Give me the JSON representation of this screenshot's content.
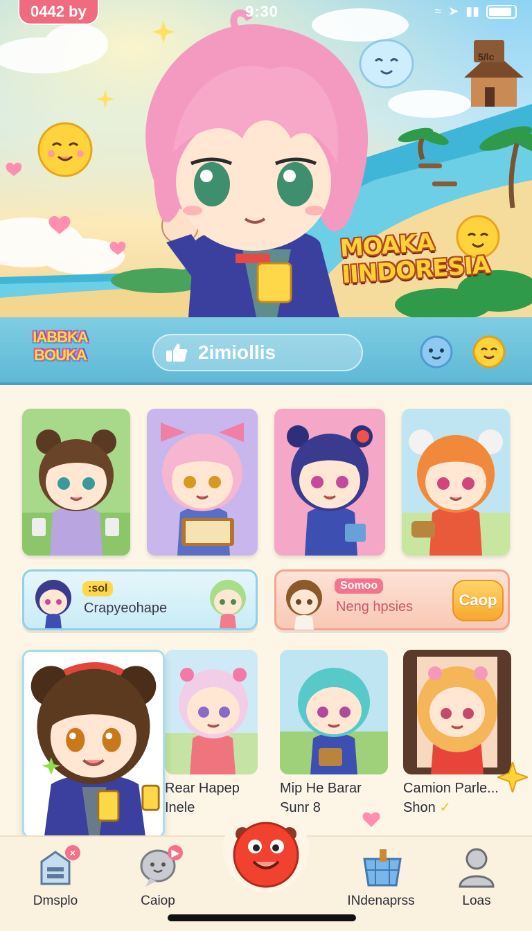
{
  "status_bar": {
    "pill_text": "0442 by",
    "time": "9:30",
    "icons": [
      "wifi-icon",
      "location-icon",
      "signal-icon",
      "battery-icon"
    ]
  },
  "hero": {
    "title_line1": "MOAKA",
    "title_line2": "IINDORESIA",
    "sign_text": "5/lc"
  },
  "header": {
    "logo_line1": "IABBKA",
    "logo_line2": "BOUKA",
    "search_value": "2imiollis",
    "search_icon": "thumbs-up-icon"
  },
  "banners": [
    {
      "tag": ":sol",
      "text": "Crapyeohape",
      "tag_color": "#ffd84a"
    },
    {
      "tag": "Somoo",
      "text": "Neng hpsies",
      "button": "Caop",
      "tag_color": "#f5738b"
    }
  ],
  "gallery": [
    {
      "line1": "Rear Hapep",
      "line2": "Inele"
    },
    {
      "line1": "Mip He Barar",
      "line2": "Sunr 8"
    },
    {
      "line1": "Camion Parle...",
      "line2": "Shon"
    }
  ],
  "nav": [
    {
      "label": "Dmsplo",
      "icon": "box-icon",
      "badge": "×"
    },
    {
      "label": "Caiop",
      "icon": "chat-bubble-icon",
      "badge": "▶"
    },
    {
      "label": "",
      "icon": "mascot-home-icon"
    },
    {
      "label": "INdenaprss",
      "icon": "basket-icon"
    },
    {
      "label": "Loas",
      "icon": "profile-icon"
    }
  ],
  "colors": {
    "background": "#fdf6e6",
    "header_bar": "#5fb9d6",
    "accent_pink": "#f06b7e",
    "accent_yellow": "#ffd23a"
  }
}
